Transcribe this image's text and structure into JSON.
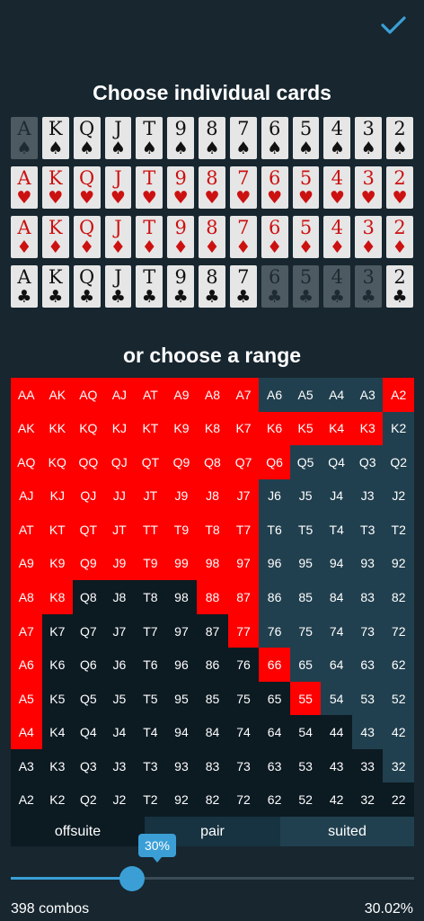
{
  "header": {
    "confirm_icon": "checkmark-icon",
    "accent": "#3b9fd6"
  },
  "cards_section": {
    "title": "Choose individual cards",
    "ranks": [
      "A",
      "K",
      "Q",
      "J",
      "T",
      "9",
      "8",
      "7",
      "6",
      "5",
      "4",
      "3",
      "2"
    ],
    "rows": [
      {
        "suit": "spades",
        "symbol": "♠",
        "color": "black",
        "dimmed": [
          "A"
        ]
      },
      {
        "suit": "hearts",
        "symbol": "♥",
        "color": "red",
        "dimmed": []
      },
      {
        "suit": "diamonds",
        "symbol": "♦",
        "color": "red",
        "dimmed": []
      },
      {
        "suit": "clubs",
        "symbol": "♣",
        "color": "black",
        "dimmed": [
          "6",
          "5",
          "4",
          "3"
        ]
      }
    ]
  },
  "range_section": {
    "title": "or choose a range",
    "selected_color": "#ff0000",
    "grid": [
      [
        "AA",
        "AK",
        "AQ",
        "AJ",
        "AT",
        "A9",
        "A8",
        "A7",
        "A6",
        "A5",
        "A4",
        "A3",
        "A2"
      ],
      [
        "AK",
        "KK",
        "KQ",
        "KJ",
        "KT",
        "K9",
        "K8",
        "K7",
        "K6",
        "K5",
        "K4",
        "K3",
        "K2"
      ],
      [
        "AQ",
        "KQ",
        "QQ",
        "QJ",
        "QT",
        "Q9",
        "Q8",
        "Q7",
        "Q6",
        "Q5",
        "Q4",
        "Q3",
        "Q2"
      ],
      [
        "AJ",
        "KJ",
        "QJ",
        "JJ",
        "JT",
        "J9",
        "J8",
        "J7",
        "J6",
        "J5",
        "J4",
        "J3",
        "J2"
      ],
      [
        "AT",
        "KT",
        "QT",
        "JT",
        "TT",
        "T9",
        "T8",
        "T7",
        "T6",
        "T5",
        "T4",
        "T3",
        "T2"
      ],
      [
        "A9",
        "K9",
        "Q9",
        "J9",
        "T9",
        "99",
        "98",
        "97",
        "96",
        "95",
        "94",
        "93",
        "92"
      ],
      [
        "A8",
        "K8",
        "Q8",
        "J8",
        "T8",
        "98",
        "88",
        "87",
        "86",
        "85",
        "84",
        "83",
        "82"
      ],
      [
        "A7",
        "K7",
        "Q7",
        "J7",
        "T7",
        "97",
        "87",
        "77",
        "76",
        "75",
        "74",
        "73",
        "72"
      ],
      [
        "A6",
        "K6",
        "Q6",
        "J6",
        "T6",
        "96",
        "86",
        "76",
        "66",
        "65",
        "64",
        "63",
        "62"
      ],
      [
        "A5",
        "K5",
        "Q5",
        "J5",
        "T5",
        "95",
        "85",
        "75",
        "65",
        "55",
        "54",
        "53",
        "52"
      ],
      [
        "A4",
        "K4",
        "Q4",
        "J4",
        "T4",
        "94",
        "84",
        "74",
        "64",
        "54",
        "44",
        "43",
        "42"
      ],
      [
        "A3",
        "K3",
        "Q3",
        "J3",
        "T3",
        "93",
        "83",
        "73",
        "63",
        "53",
        "43",
        "33",
        "32"
      ],
      [
        "A2",
        "K2",
        "Q2",
        "J2",
        "T2",
        "92",
        "82",
        "72",
        "62",
        "52",
        "42",
        "32",
        "22"
      ]
    ],
    "selected": [
      [
        0,
        0
      ],
      [
        0,
        1
      ],
      [
        0,
        2
      ],
      [
        0,
        3
      ],
      [
        0,
        4
      ],
      [
        0,
        5
      ],
      [
        0,
        6
      ],
      [
        0,
        7
      ],
      [
        0,
        12
      ],
      [
        1,
        0
      ],
      [
        1,
        1
      ],
      [
        1,
        2
      ],
      [
        1,
        3
      ],
      [
        1,
        4
      ],
      [
        1,
        5
      ],
      [
        1,
        6
      ],
      [
        1,
        7
      ],
      [
        1,
        8
      ],
      [
        1,
        9
      ],
      [
        1,
        10
      ],
      [
        1,
        11
      ],
      [
        2,
        0
      ],
      [
        2,
        1
      ],
      [
        2,
        2
      ],
      [
        2,
        3
      ],
      [
        2,
        4
      ],
      [
        2,
        5
      ],
      [
        2,
        6
      ],
      [
        2,
        7
      ],
      [
        2,
        8
      ],
      [
        3,
        0
      ],
      [
        3,
        1
      ],
      [
        3,
        2
      ],
      [
        3,
        3
      ],
      [
        3,
        4
      ],
      [
        3,
        5
      ],
      [
        3,
        6
      ],
      [
        3,
        7
      ],
      [
        4,
        0
      ],
      [
        4,
        1
      ],
      [
        4,
        2
      ],
      [
        4,
        3
      ],
      [
        4,
        4
      ],
      [
        4,
        5
      ],
      [
        4,
        6
      ],
      [
        4,
        7
      ],
      [
        5,
        0
      ],
      [
        5,
        1
      ],
      [
        5,
        2
      ],
      [
        5,
        3
      ],
      [
        5,
        4
      ],
      [
        5,
        5
      ],
      [
        5,
        6
      ],
      [
        5,
        7
      ],
      [
        6,
        0
      ],
      [
        6,
        1
      ],
      [
        6,
        6
      ],
      [
        6,
        7
      ],
      [
        7,
        0
      ],
      [
        7,
        7
      ],
      [
        8,
        0
      ],
      [
        8,
        8
      ],
      [
        9,
        0
      ],
      [
        9,
        9
      ],
      [
        10,
        0
      ]
    ],
    "legend": {
      "offsuit": "offsuite",
      "pair": "pair",
      "suited": "suited"
    }
  },
  "slider": {
    "value_label": "30%",
    "fraction": 0.3
  },
  "footer": {
    "combos": "398 combos",
    "percent": "30.02%"
  }
}
